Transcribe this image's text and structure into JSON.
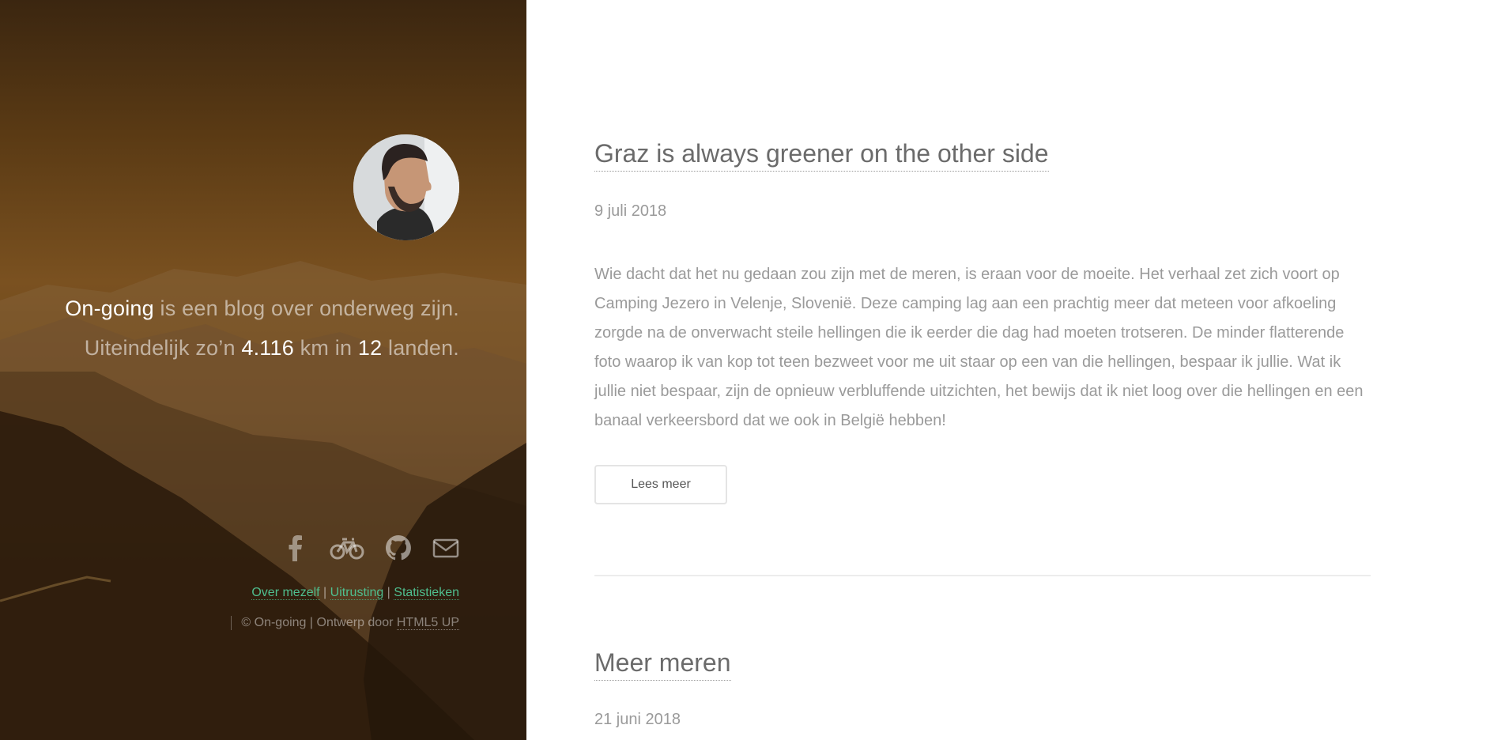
{
  "sidebar": {
    "intro": {
      "blog_name": "On-going",
      "line1_rest": " is een blog over onderweg zijn.",
      "line2_start": "Uiteindelijk zo’n ",
      "km": "4.116",
      "line2_mid": " km in ",
      "countries": "12",
      "line2_end": " landen."
    },
    "socials": [
      "facebook-icon",
      "bicycle-icon",
      "github-icon",
      "envelope-icon"
    ],
    "footer_links": {
      "about": "Over mezelf",
      "sep1": " | ",
      "gear": "Uitrusting",
      "sep2": " | ",
      "stats": "Statistieken"
    },
    "copyright": {
      "text": "© On-going | Ontwerp door ",
      "credit": "HTML5 UP"
    }
  },
  "posts": [
    {
      "title": "Graz is always greener on the other side",
      "date": "9 juli 2018",
      "body": "Wie dacht dat het nu gedaan zou zijn met de meren, is eraan voor de moeite. Het verhaal zet zich voort op Camping Jezero in Velenje, Slovenië. Deze camping lag aan een prachtig meer dat meteen voor afkoeling zorgde na de onverwacht steile hellingen die ik eerder die dag had moeten trotseren. De minder flatterende foto waarop ik van kop tot teen bezweet voor me uit staar op een van die hellingen, bespaar ik jullie. Wat ik jullie niet bespaar, zijn de opnieuw verbluffende uitzichten, het bewijs dat ik niet loog over die hellingen en een banaal verkeersbord dat we ook in België hebben!",
      "read_more": "Lees meer"
    },
    {
      "title": "Meer meren",
      "date": "21 juni 2018"
    }
  ],
  "colors": {
    "accent": "#4fbf8f",
    "text_muted": "#9a9a9a",
    "title": "#6b6b6b"
  }
}
